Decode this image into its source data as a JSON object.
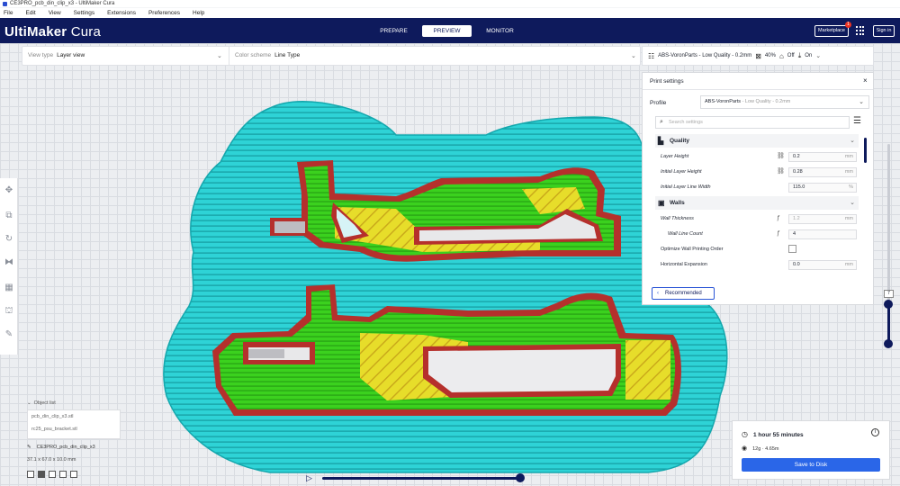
{
  "window": {
    "title": "CE3PRO_pcb_din_clip_x3 - UltiMaker Cura"
  },
  "menu": [
    "File",
    "Edit",
    "View",
    "Settings",
    "Extensions",
    "Preferences",
    "Help"
  ],
  "header": {
    "logo_bold": "UltiMaker",
    "logo_light": " Cura",
    "stages": [
      "PREPARE",
      "PREVIEW",
      "MONITOR"
    ],
    "active_stage": "PREVIEW",
    "marketplace": "Marketplace",
    "marketplace_badge": "1",
    "signin": "Sign in"
  },
  "viewbar": {
    "view_type_label": "View type",
    "view_type_value": "Layer view",
    "color_scheme_label": "Color scheme",
    "color_scheme_value": "Line Type"
  },
  "settings_summary": {
    "profile": "ABS-VoronParts - Low Quality - 0.2mm",
    "infill": "40%",
    "support": "Off",
    "adhesion": "On"
  },
  "print_settings": {
    "title": "Print settings",
    "profile_label": "Profile",
    "profile_name": "ABS-VoronParts",
    "profile_suffix": " - Low Quality - 0.2mm",
    "search_placeholder": "Search settings",
    "categories": {
      "quality": "Quality",
      "walls": "Walls"
    },
    "rows": [
      {
        "name": "Layer Height",
        "value": "0.2",
        "unit": "mm"
      },
      {
        "name": "Initial Layer Height",
        "value": "0.28",
        "unit": "mm"
      },
      {
        "name": "Initial Layer Line Width",
        "value": "115.0",
        "unit": "%"
      },
      {
        "name": "Wall Thickness",
        "value": "1.2",
        "unit": "mm"
      },
      {
        "name": "Wall Line Count",
        "value": "4",
        "unit": ""
      },
      {
        "name": "Optimize Wall Printing Order",
        "value": "",
        "unit": ""
      },
      {
        "name": "Horizontal Expansion",
        "value": "0.0",
        "unit": "mm"
      }
    ],
    "recommended": "Recommended"
  },
  "object_list": {
    "toggle": "Object list",
    "items": [
      "pcb_din_clip_x3.stl",
      "rc25_psu_bracket.stl"
    ],
    "current_name": "CE3PRO_pcb_din_clip_x3",
    "dimensions": "37.1 x 67.0 x 10.0 mm"
  },
  "layer_slider": {
    "current": "7"
  },
  "action": {
    "time": "1 hour 55 minutes",
    "material": "12g · 4.65m",
    "save": "Save to Disk"
  },
  "colors": {
    "header_bg": "#0e1a5c",
    "skirt_cyan": "#2ed3d6",
    "outer_wall_red": "#b5302c",
    "inner_wall_green": "#3bd11e",
    "infill_yellow": "#e7dd2a",
    "save_button": "#2a66e8"
  }
}
